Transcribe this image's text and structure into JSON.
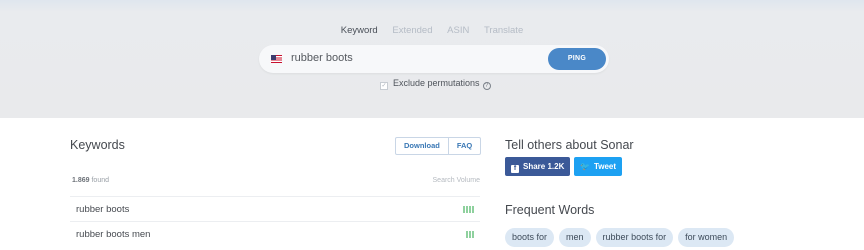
{
  "search": {
    "tabs": [
      {
        "label": "Keyword",
        "active": true
      },
      {
        "label": "Extended",
        "active": false
      },
      {
        "label": "ASIN",
        "active": false
      },
      {
        "label": "Translate",
        "active": false
      }
    ],
    "query": "rubber boots",
    "marketplace_flag": "us-flag-icon",
    "ping_label": "PING",
    "exclude_permutations_label": "Exclude permutations",
    "exclude_permutations_checked": true
  },
  "keywords": {
    "title": "Keywords",
    "download_label": "Download",
    "faq_label": "FAQ",
    "found_count": "1.869",
    "found_label": "found",
    "volume_header": "Search Volume",
    "rows": [
      {
        "keyword": "rubber boots",
        "volume_bars": 4
      },
      {
        "keyword": "rubber boots men",
        "volume_bars": 3
      }
    ]
  },
  "share": {
    "title": "Tell others about Sonar",
    "facebook_label": "Share 1.2K",
    "twitter_label": "Tweet"
  },
  "frequent_words": {
    "title": "Frequent Words",
    "words": [
      "boots for",
      "men",
      "rubber boots for",
      "for women"
    ]
  },
  "colors": {
    "accent": "#4a88c8",
    "volume_bar": "#8fd19e",
    "facebook": "#3b5998",
    "twitter": "#1da1f2",
    "chip_bg": "#dce8f4"
  }
}
